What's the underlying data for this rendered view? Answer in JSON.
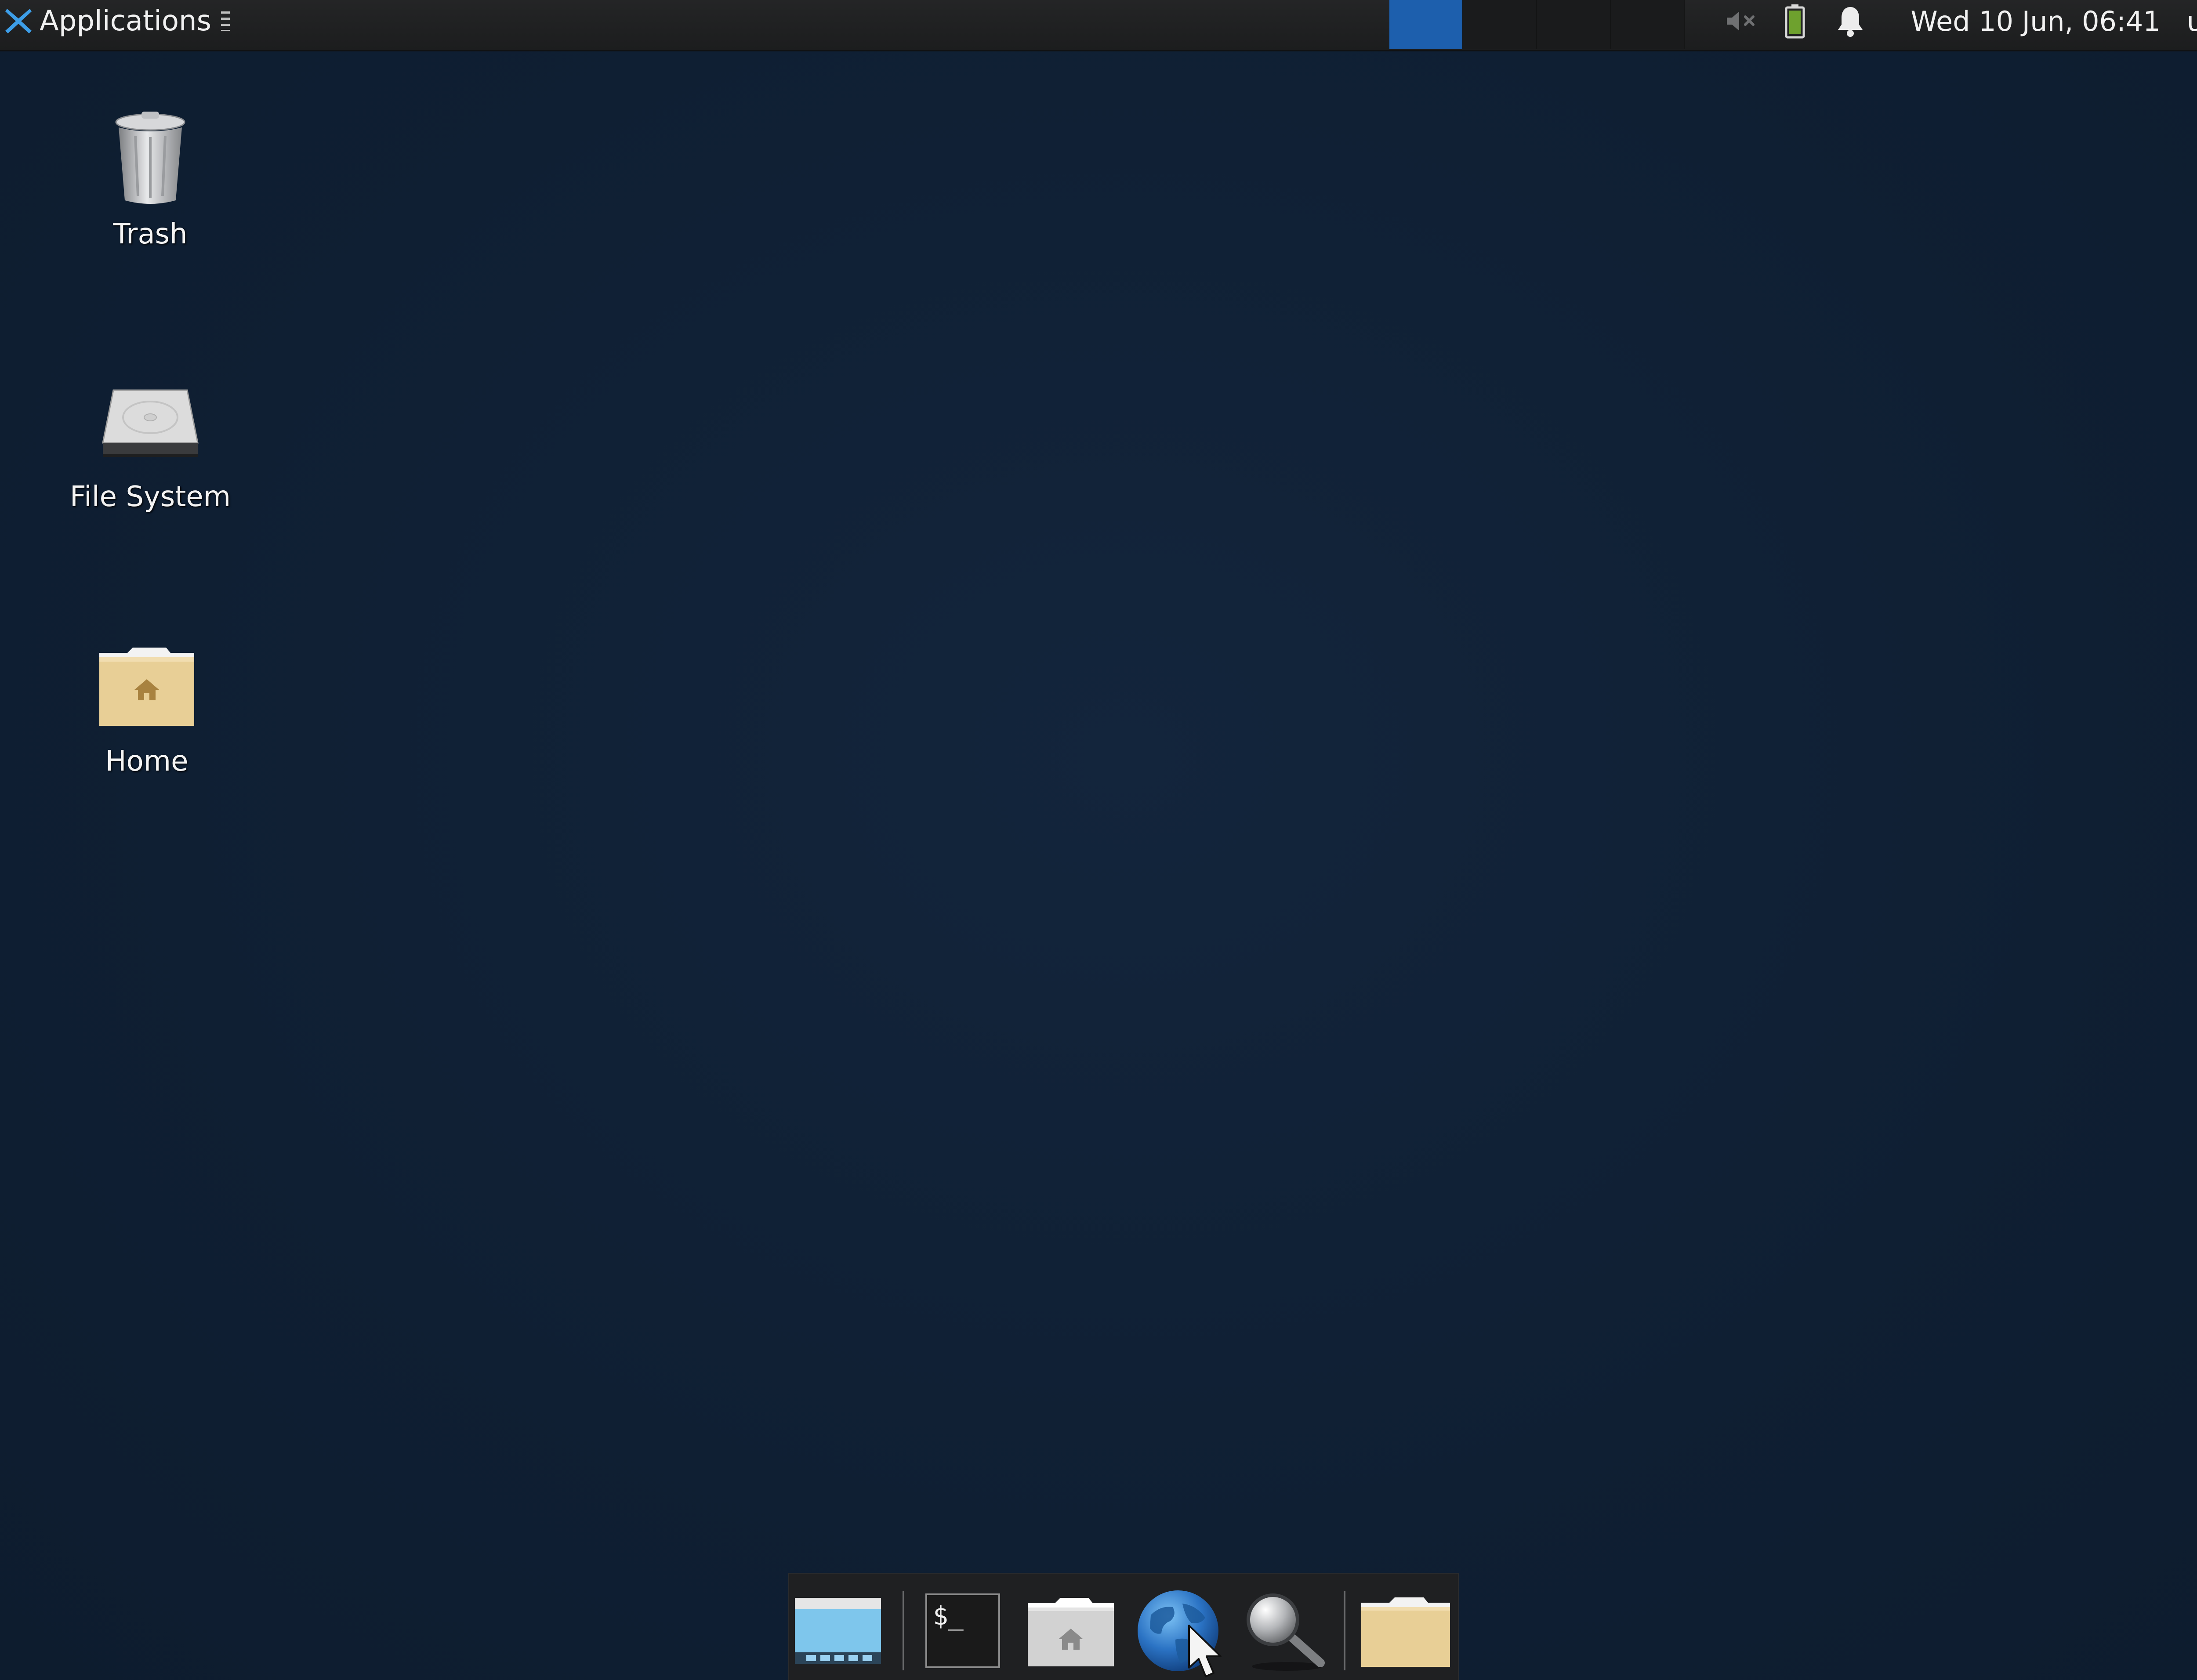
{
  "top_panel": {
    "applications_label": "Applications",
    "clock": "Wed 10 Jun, 06:41",
    "user": "user",
    "workspaces": [
      {
        "name": "workspace-1",
        "active": true
      },
      {
        "name": "workspace-2",
        "active": false
      },
      {
        "name": "workspace-3",
        "active": false
      },
      {
        "name": "workspace-4",
        "active": false
      }
    ],
    "tray_icons": [
      "volume-muted-icon",
      "battery-icon",
      "notification-bell-icon"
    ]
  },
  "desktop": {
    "icons": [
      {
        "label": "Trash",
        "icon": "trash-icon"
      },
      {
        "label": "File System",
        "icon": "hard-drive-icon"
      },
      {
        "label": "Home",
        "icon": "home-folder-icon"
      }
    ]
  },
  "dock": {
    "items": [
      {
        "icon": "show-desktop-icon"
      },
      {
        "icon": "terminal-icon",
        "text": "$_"
      },
      {
        "icon": "file-manager-icon"
      },
      {
        "icon": "web-browser-icon"
      },
      {
        "icon": "app-finder-icon"
      },
      {
        "icon": "folder-icon"
      }
    ]
  },
  "colors": {
    "desktop_background": "#0f1f33",
    "panel_background": "#1f2021",
    "active_workspace": "#1d5fad",
    "battery_green": "#6ea12e",
    "folder_tan": "#e8cf96"
  }
}
